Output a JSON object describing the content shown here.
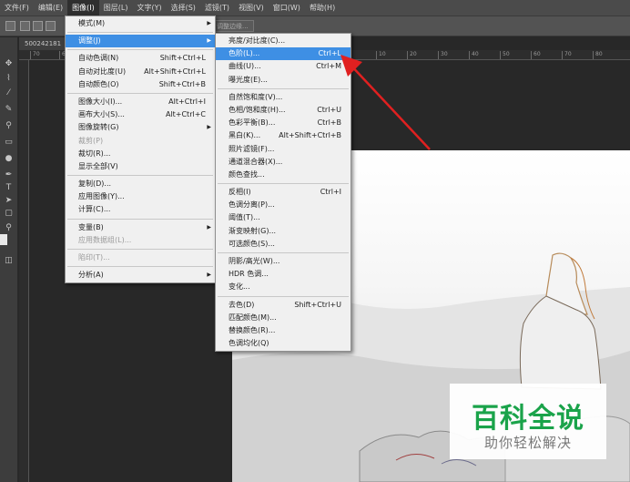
{
  "menubar": {
    "items": [
      "文件(F)",
      "编辑(E)",
      "图像(I)",
      "图层(L)",
      "文字(Y)",
      "选择(S)",
      "滤镜(T)",
      "视图(V)",
      "窗口(W)",
      "帮助(H)"
    ]
  },
  "options": {
    "button_label": "调整边缘..."
  },
  "document": {
    "tab_label": "500242181"
  },
  "ruler": {
    "ticks": [
      "70",
      "60",
      "10",
      "20",
      "30",
      "40",
      "50",
      "60",
      "70",
      "80",
      "90",
      "100",
      "110",
      "120"
    ]
  },
  "image_menu": {
    "items": [
      {
        "label": "模式(M)",
        "submenu": true
      },
      {
        "sep": true
      },
      {
        "label": "调整(J)",
        "submenu": true,
        "highlighted": true
      },
      {
        "sep": true
      },
      {
        "label": "自动色调(N)",
        "shortcut": "Shift+Ctrl+L"
      },
      {
        "label": "自动对比度(U)",
        "shortcut": "Alt+Shift+Ctrl+L"
      },
      {
        "label": "自动颜色(O)",
        "shortcut": "Shift+Ctrl+B"
      },
      {
        "sep": true
      },
      {
        "label": "图像大小(I)...",
        "shortcut": "Alt+Ctrl+I"
      },
      {
        "label": "画布大小(S)...",
        "shortcut": "Alt+Ctrl+C"
      },
      {
        "label": "图像旋转(G)",
        "submenu": true
      },
      {
        "label": "裁剪(P)",
        "disabled": true
      },
      {
        "label": "裁切(R)..."
      },
      {
        "label": "显示全部(V)"
      },
      {
        "sep": true
      },
      {
        "label": "复制(D)..."
      },
      {
        "label": "应用图像(Y)..."
      },
      {
        "label": "计算(C)..."
      },
      {
        "sep": true
      },
      {
        "label": "变量(B)",
        "submenu": true
      },
      {
        "label": "应用数据组(L)...",
        "disabled": true
      },
      {
        "sep": true
      },
      {
        "label": "陷印(T)...",
        "disabled": true
      },
      {
        "sep": true
      },
      {
        "label": "分析(A)",
        "submenu": true
      }
    ]
  },
  "adjust_menu": {
    "items": [
      {
        "label": "亮度/对比度(C)..."
      },
      {
        "label": "色阶(L)...",
        "shortcut": "Ctrl+L",
        "highlighted": true
      },
      {
        "label": "曲线(U)...",
        "shortcut": "Ctrl+M"
      },
      {
        "label": "曝光度(E)..."
      },
      {
        "sep": true
      },
      {
        "label": "自然饱和度(V)..."
      },
      {
        "label": "色相/饱和度(H)...",
        "shortcut": "Ctrl+U"
      },
      {
        "label": "色彩平衡(B)...",
        "shortcut": "Ctrl+B"
      },
      {
        "label": "黑白(K)...",
        "shortcut": "Alt+Shift+Ctrl+B"
      },
      {
        "label": "照片滤镜(F)..."
      },
      {
        "label": "通道混合器(X)..."
      },
      {
        "label": "颜色查找..."
      },
      {
        "sep": true
      },
      {
        "label": "反相(I)",
        "shortcut": "Ctrl+I"
      },
      {
        "label": "色调分离(P)..."
      },
      {
        "label": "阈值(T)..."
      },
      {
        "label": "渐变映射(G)..."
      },
      {
        "label": "可选颜色(S)..."
      },
      {
        "sep": true
      },
      {
        "label": "阴影/高光(W)..."
      },
      {
        "label": "HDR 色调..."
      },
      {
        "label": "变化..."
      },
      {
        "sep": true
      },
      {
        "label": "去色(D)",
        "shortcut": "Shift+Ctrl+U"
      },
      {
        "label": "匹配颜色(M)..."
      },
      {
        "label": "替换颜色(R)..."
      },
      {
        "label": "色调均化(Q)"
      }
    ]
  },
  "watermark": {
    "title": "百科全说",
    "subtitle": "助你轻松解决"
  },
  "colors": {
    "highlight": "#3e8fe4",
    "arrow": "#e02020",
    "watermark_green": "#1aa34a"
  }
}
